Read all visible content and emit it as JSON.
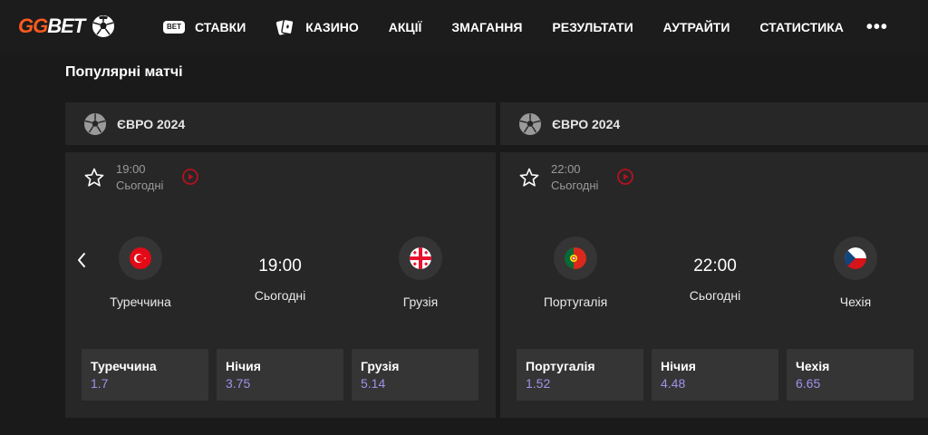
{
  "brand": {
    "gg": "GG",
    "bet": "BET"
  },
  "nav": {
    "items": [
      {
        "label": "СТАВКИ",
        "badge": "BET"
      },
      {
        "label": "КАЗИНО"
      },
      {
        "label": "АКЦІЇ"
      },
      {
        "label": "ЗМАГАННЯ"
      },
      {
        "label": "РЕЗУЛЬТАТИ"
      },
      {
        "label": "АУТРАЙТИ"
      },
      {
        "label": "СТАТИСТИКА"
      }
    ],
    "more": "•••"
  },
  "page_title": "Популярні матчі",
  "matches": [
    {
      "league": "ЄВРО 2024",
      "time": "19:00",
      "day": "Сьогодні",
      "home": {
        "name": "Туреччина",
        "flag": "turkey"
      },
      "away": {
        "name": "Грузія",
        "flag": "georgia"
      },
      "odds": [
        {
          "label": "Туреччина",
          "value": "1.7"
        },
        {
          "label": "Нічия",
          "value": "3.75"
        },
        {
          "label": "Грузія",
          "value": "5.14"
        }
      ]
    },
    {
      "league": "ЄВРО 2024",
      "time": "22:00",
      "day": "Сьогодні",
      "home": {
        "name": "Португалія",
        "flag": "portugal"
      },
      "away": {
        "name": "Чехія",
        "flag": "czechia"
      },
      "odds": [
        {
          "label": "Португалія",
          "value": "1.52"
        },
        {
          "label": "Нічия",
          "value": "4.48"
        },
        {
          "label": "Чехія",
          "value": "6.65"
        }
      ]
    }
  ],
  "colors": {
    "accent": "#ff5a1f",
    "odds_value": "#9e93ea",
    "card_bg": "#272727",
    "page_bg": "#1a1a1a",
    "live": "#d0021b"
  }
}
